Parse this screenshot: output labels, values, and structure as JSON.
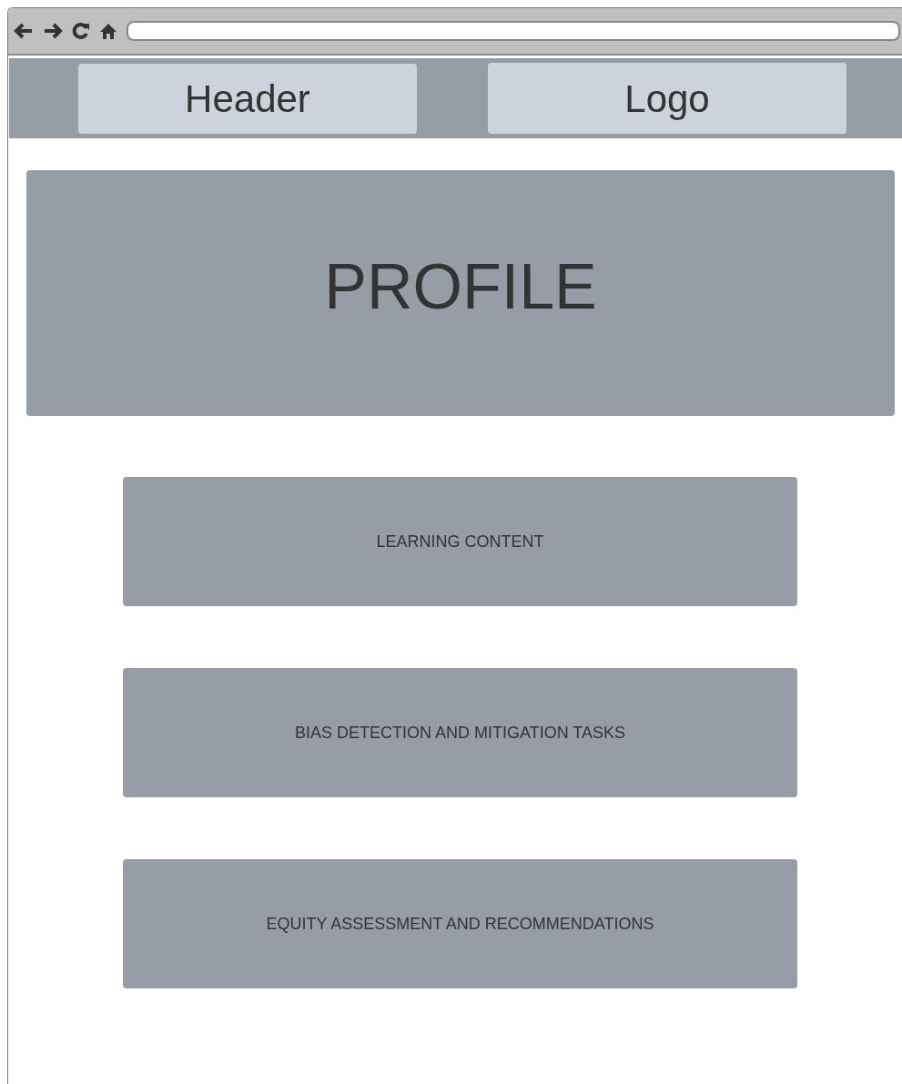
{
  "header": {
    "title": "Header",
    "logo": "Logo"
  },
  "profile": {
    "title": "PROFILE"
  },
  "sections": [
    {
      "label": "LEARNING CONTENT"
    },
    {
      "label": "BIAS DETECTION AND MITIGATION TASKS"
    },
    {
      "label": "EQUITY ASSESSMENT AND RECOMMENDATIONS"
    }
  ]
}
